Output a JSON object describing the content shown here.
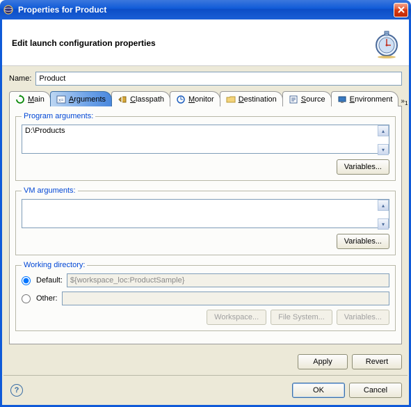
{
  "titlebar": {
    "title": "Properties for Product"
  },
  "header": {
    "text": "Edit launch configuration properties"
  },
  "name": {
    "label": "Name:",
    "value": "Product"
  },
  "tabs": [
    {
      "label": "Main",
      "mnemonic": "M"
    },
    {
      "label": "Arguments",
      "mnemonic": "A"
    },
    {
      "label": "Classpath",
      "mnemonic": "C"
    },
    {
      "label": "Monitor",
      "mnemonic": "M"
    },
    {
      "label": "Destination",
      "mnemonic": "D"
    },
    {
      "label": "Source",
      "mnemonic": "S"
    },
    {
      "label": "Environment",
      "mnemonic": "E"
    }
  ],
  "more_indicator": "1",
  "program_args": {
    "legend": "Program arguments:",
    "value": "D:\\Products",
    "variables_btn": "Variables..."
  },
  "vm_args": {
    "legend": "VM arguments:",
    "value": "",
    "variables_btn": "Variables..."
  },
  "working_dir": {
    "legend": "Working directory:",
    "default_label": "Default:",
    "default_value": "${workspace_loc:ProductSample}",
    "other_label": "Other:",
    "other_value": "",
    "workspace_btn": "Workspace...",
    "filesystem_btn": "File System...",
    "variables_btn": "Variables..."
  },
  "actions": {
    "apply": "Apply",
    "revert": "Revert",
    "ok": "OK",
    "cancel": "Cancel"
  }
}
